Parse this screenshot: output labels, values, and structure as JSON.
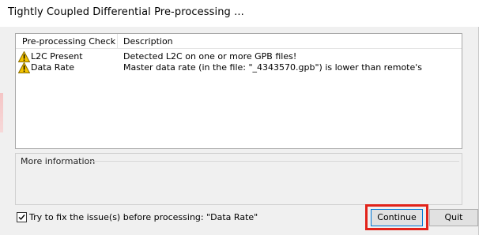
{
  "window": {
    "title": "Tightly Coupled Differential Pre-processing ..."
  },
  "checks_list": {
    "columns": [
      "Pre-processing Check",
      "Description"
    ],
    "rows": [
      {
        "icon": "warning-icon",
        "check": "L2C Present",
        "description": "Detected L2C on one or more GPB files!"
      },
      {
        "icon": "warning-icon",
        "check": "Data Rate",
        "description": "Master data rate (in the file: \"_4343570.gpb\") is lower than remote's"
      }
    ]
  },
  "more_info": {
    "label": "More information"
  },
  "fix_option": {
    "label": "Try to fix the issue(s) before processing: \"Data Rate\"",
    "checked": true
  },
  "buttons": {
    "continue_label": "Continue",
    "quit_label": "Quit"
  },
  "colors": {
    "highlight": "#e2231a",
    "warning_fill": "#f5c400",
    "focus_border": "#0078d7"
  }
}
